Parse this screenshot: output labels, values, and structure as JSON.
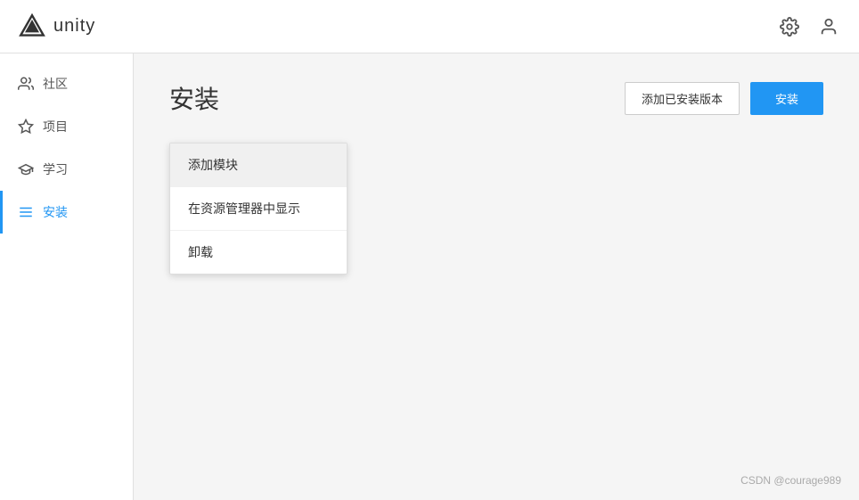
{
  "header": {
    "logo_text": "unity",
    "gear_icon": "⚙",
    "user_icon": "👤"
  },
  "sidebar": {
    "items": [
      {
        "id": "community",
        "label": "社区",
        "icon": "community"
      },
      {
        "id": "projects",
        "label": "项目",
        "icon": "project"
      },
      {
        "id": "learn",
        "label": "学习",
        "icon": "learn"
      },
      {
        "id": "install",
        "label": "安装",
        "icon": "install",
        "active": true
      }
    ]
  },
  "main": {
    "page_title": "安装",
    "btn_add_installed": "添加已安装版本",
    "btn_install": "安装",
    "context_menu": {
      "items": [
        {
          "id": "add-module",
          "label": "添加模块",
          "highlighted": true
        },
        {
          "id": "show-in-explorer",
          "label": "在资源管理器中显示",
          "highlighted": false
        },
        {
          "id": "uninstall",
          "label": "卸载",
          "highlighted": false
        }
      ]
    }
  },
  "watermark": {
    "text": "CSDN @courage989"
  }
}
